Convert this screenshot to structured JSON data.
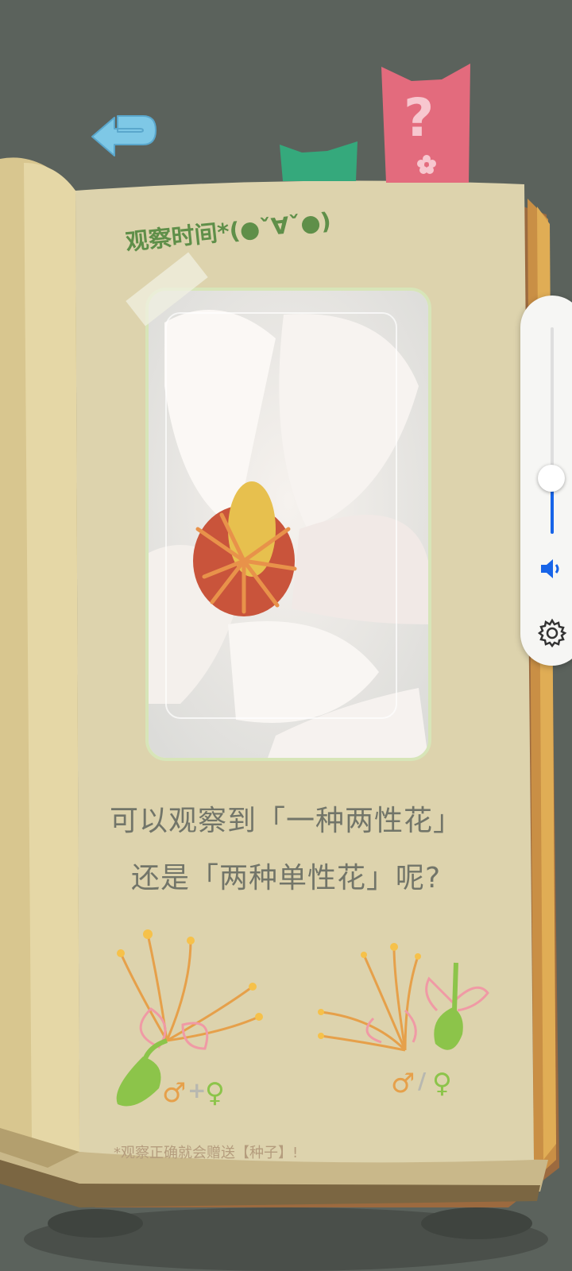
{
  "header": {
    "back_label": "",
    "help_label": "?"
  },
  "page": {
    "title": "观察时间*(●ˇ∀ˇ●)",
    "question_line1": "可以观察到「一种两性花」",
    "question_line2": "还是「两种单性花」呢?",
    "note": "*观察正确就会赠送【种子】!"
  },
  "diagram": {
    "left_symbols": {
      "male": "♂",
      "plus": "+",
      "female": "♀"
    },
    "right_symbols": {
      "male": "♂",
      "slash": "/",
      "female": "♀"
    }
  },
  "volume": {
    "level_percent": 25,
    "speaker_icon": "speaker-icon",
    "settings_icon": "gear-icon"
  },
  "colors": {
    "background": "#5b625c",
    "page": "#ddd3ad",
    "title_green": "#5f8f49",
    "help_pink": "#e36b7d",
    "bookmark_green": "#35a97c",
    "back_arrow": "#7ec8e6",
    "slider_blue": "#1764e8"
  }
}
